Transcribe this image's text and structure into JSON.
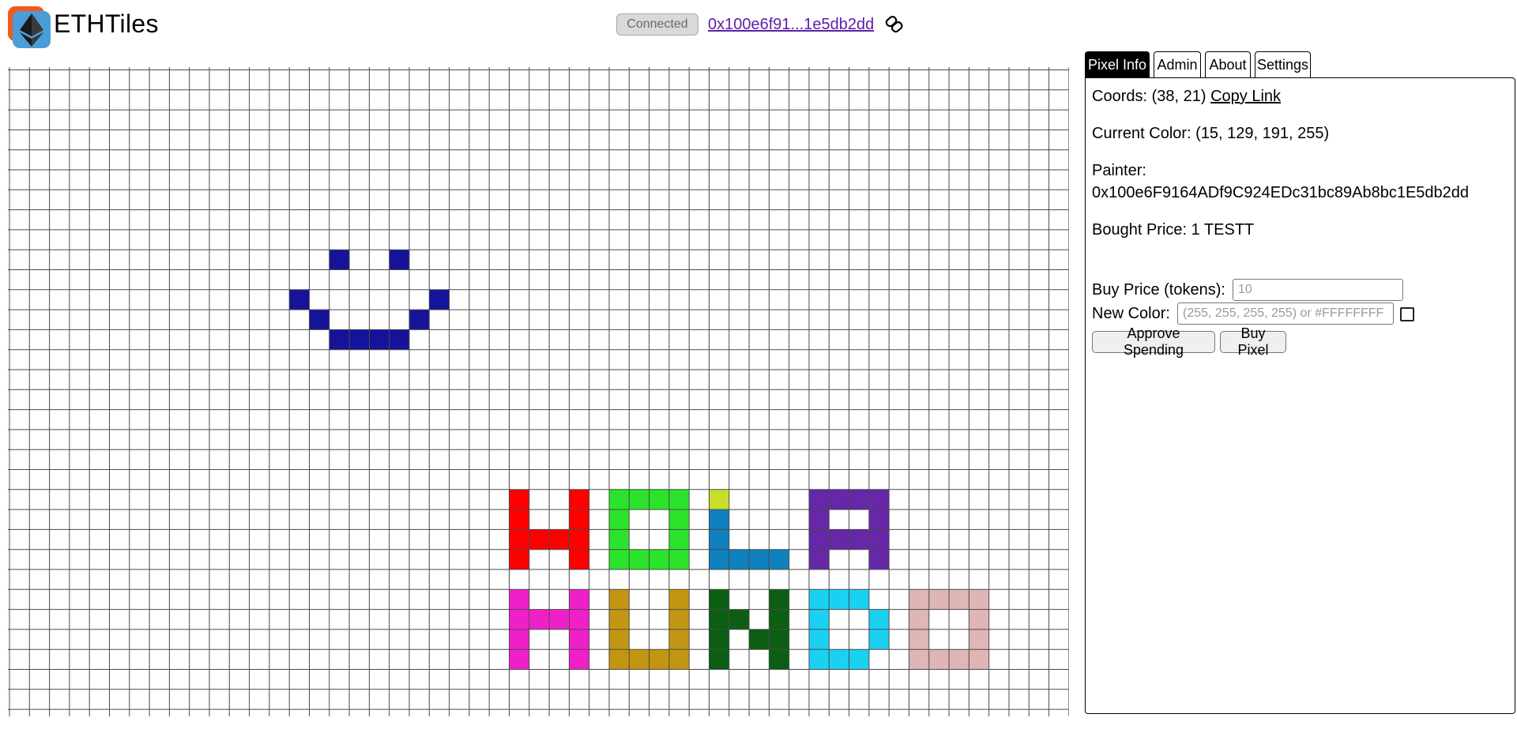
{
  "header": {
    "brand": "ETHTiles",
    "connection_status": "Connected",
    "account_short": "0x100e6f91...1e5db2dd"
  },
  "canvas": {
    "pixels": [
      {
        "x": 16,
        "y": 9,
        "color": "#15139a"
      },
      {
        "x": 19,
        "y": 9,
        "color": "#15139a"
      },
      {
        "x": 14,
        "y": 11,
        "color": "#15139a"
      },
      {
        "x": 21,
        "y": 11,
        "color": "#15139a"
      },
      {
        "x": 15,
        "y": 12,
        "color": "#15139a"
      },
      {
        "x": 20,
        "y": 12,
        "color": "#15139a"
      },
      {
        "x": 16,
        "y": 13,
        "color": "#15139a"
      },
      {
        "x": 17,
        "y": 13,
        "color": "#15139a"
      },
      {
        "x": 18,
        "y": 13,
        "color": "#15139a"
      },
      {
        "x": 19,
        "y": 13,
        "color": "#15139a"
      },
      {
        "x": 25,
        "y": 21,
        "color": "#ff0000"
      },
      {
        "x": 25,
        "y": 22,
        "color": "#ff0000"
      },
      {
        "x": 25,
        "y": 23,
        "color": "#ff0000"
      },
      {
        "x": 25,
        "y": 24,
        "color": "#ff0000"
      },
      {
        "x": 26,
        "y": 23,
        "color": "#ff0000"
      },
      {
        "x": 28,
        "y": 21,
        "color": "#ff0000"
      },
      {
        "x": 28,
        "y": 22,
        "color": "#ff0000"
      },
      {
        "x": 28,
        "y": 23,
        "color": "#ff0000"
      },
      {
        "x": 28,
        "y": 24,
        "color": "#ff0000"
      },
      {
        "x": 27,
        "y": 23,
        "color": "#ff0000"
      },
      {
        "x": 30,
        "y": 21,
        "color": "#2be32b"
      },
      {
        "x": 31,
        "y": 21,
        "color": "#2be32b"
      },
      {
        "x": 32,
        "y": 21,
        "color": "#2be32b"
      },
      {
        "x": 33,
        "y": 21,
        "color": "#2be32b"
      },
      {
        "x": 30,
        "y": 22,
        "color": "#2be32b"
      },
      {
        "x": 33,
        "y": 22,
        "color": "#2be32b"
      },
      {
        "x": 30,
        "y": 23,
        "color": "#2be32b"
      },
      {
        "x": 33,
        "y": 23,
        "color": "#2be32b"
      },
      {
        "x": 30,
        "y": 24,
        "color": "#2be32b"
      },
      {
        "x": 31,
        "y": 24,
        "color": "#2be32b"
      },
      {
        "x": 32,
        "y": 24,
        "color": "#2be32b"
      },
      {
        "x": 33,
        "y": 24,
        "color": "#2be32b"
      },
      {
        "x": 35,
        "y": 21,
        "color": "#c9dd2b"
      },
      {
        "x": 35,
        "y": 22,
        "color": "#0f81bf"
      },
      {
        "x": 35,
        "y": 23,
        "color": "#0f81bf"
      },
      {
        "x": 35,
        "y": 24,
        "color": "#0f81bf"
      },
      {
        "x": 36,
        "y": 24,
        "color": "#0f81bf"
      },
      {
        "x": 37,
        "y": 24,
        "color": "#0f81bf"
      },
      {
        "x": 38,
        "y": 24,
        "color": "#0f81bf"
      },
      {
        "x": 40,
        "y": 21,
        "color": "#6627a8"
      },
      {
        "x": 41,
        "y": 21,
        "color": "#6627a8"
      },
      {
        "x": 42,
        "y": 21,
        "color": "#6627a8"
      },
      {
        "x": 43,
        "y": 21,
        "color": "#6627a8"
      },
      {
        "x": 40,
        "y": 22,
        "color": "#6627a8"
      },
      {
        "x": 43,
        "y": 22,
        "color": "#6627a8"
      },
      {
        "x": 40,
        "y": 23,
        "color": "#6627a8"
      },
      {
        "x": 41,
        "y": 23,
        "color": "#6627a8"
      },
      {
        "x": 42,
        "y": 23,
        "color": "#6627a8"
      },
      {
        "x": 43,
        "y": 23,
        "color": "#6627a8"
      },
      {
        "x": 40,
        "y": 24,
        "color": "#6627a8"
      },
      {
        "x": 43,
        "y": 24,
        "color": "#6627a8"
      },
      {
        "x": 25,
        "y": 26,
        "color": "#f020c9"
      },
      {
        "x": 25,
        "y": 27,
        "color": "#f020c9"
      },
      {
        "x": 25,
        "y": 28,
        "color": "#f020c9"
      },
      {
        "x": 25,
        "y": 29,
        "color": "#f020c9"
      },
      {
        "x": 26,
        "y": 27,
        "color": "#f020c9"
      },
      {
        "x": 27,
        "y": 27,
        "color": "#f020c9"
      },
      {
        "x": 28,
        "y": 26,
        "color": "#f020c9"
      },
      {
        "x": 28,
        "y": 27,
        "color": "#f020c9"
      },
      {
        "x": 28,
        "y": 28,
        "color": "#f020c9"
      },
      {
        "x": 28,
        "y": 29,
        "color": "#f020c9"
      },
      {
        "x": 30,
        "y": 26,
        "color": "#c29612"
      },
      {
        "x": 30,
        "y": 27,
        "color": "#c29612"
      },
      {
        "x": 30,
        "y": 28,
        "color": "#c29612"
      },
      {
        "x": 30,
        "y": 29,
        "color": "#c29612"
      },
      {
        "x": 31,
        "y": 29,
        "color": "#c29612"
      },
      {
        "x": 32,
        "y": 29,
        "color": "#c29612"
      },
      {
        "x": 33,
        "y": 26,
        "color": "#c29612"
      },
      {
        "x": 33,
        "y": 27,
        "color": "#c29612"
      },
      {
        "x": 33,
        "y": 28,
        "color": "#c29612"
      },
      {
        "x": 33,
        "y": 29,
        "color": "#c29612"
      },
      {
        "x": 35,
        "y": 26,
        "color": "#0b5e12"
      },
      {
        "x": 35,
        "y": 27,
        "color": "#0b5e12"
      },
      {
        "x": 35,
        "y": 28,
        "color": "#0b5e12"
      },
      {
        "x": 35,
        "y": 29,
        "color": "#0b5e12"
      },
      {
        "x": 36,
        "y": 27,
        "color": "#0b5e12"
      },
      {
        "x": 37,
        "y": 28,
        "color": "#0b5e12"
      },
      {
        "x": 38,
        "y": 26,
        "color": "#0b5e12"
      },
      {
        "x": 38,
        "y": 27,
        "color": "#0b5e12"
      },
      {
        "x": 38,
        "y": 28,
        "color": "#0b5e12"
      },
      {
        "x": 38,
        "y": 29,
        "color": "#0b5e12"
      },
      {
        "x": 40,
        "y": 26,
        "color": "#1ad1f2"
      },
      {
        "x": 41,
        "y": 26,
        "color": "#1ad1f2"
      },
      {
        "x": 42,
        "y": 26,
        "color": "#1ad1f2"
      },
      {
        "x": 40,
        "y": 27,
        "color": "#1ad1f2"
      },
      {
        "x": 43,
        "y": 27,
        "color": "#1ad1f2"
      },
      {
        "x": 40,
        "y": 28,
        "color": "#1ad1f2"
      },
      {
        "x": 43,
        "y": 28,
        "color": "#1ad1f2"
      },
      {
        "x": 40,
        "y": 29,
        "color": "#1ad1f2"
      },
      {
        "x": 41,
        "y": 29,
        "color": "#1ad1f2"
      },
      {
        "x": 42,
        "y": 29,
        "color": "#1ad1f2"
      },
      {
        "x": 45,
        "y": 26,
        "color": "#dfb5b5"
      },
      {
        "x": 46,
        "y": 26,
        "color": "#dfb5b5"
      },
      {
        "x": 47,
        "y": 26,
        "color": "#dfb5b5"
      },
      {
        "x": 48,
        "y": 26,
        "color": "#dfb5b5"
      },
      {
        "x": 45,
        "y": 27,
        "color": "#dfb5b5"
      },
      {
        "x": 48,
        "y": 27,
        "color": "#dfb5b5"
      },
      {
        "x": 45,
        "y": 28,
        "color": "#dfb5b5"
      },
      {
        "x": 48,
        "y": 28,
        "color": "#dfb5b5"
      },
      {
        "x": 45,
        "y": 29,
        "color": "#dfb5b5"
      },
      {
        "x": 46,
        "y": 29,
        "color": "#dfb5b5"
      },
      {
        "x": 47,
        "y": 29,
        "color": "#dfb5b5"
      },
      {
        "x": 48,
        "y": 29,
        "color": "#dfb5b5"
      }
    ]
  },
  "tabs": [
    {
      "label": "Pixel Info",
      "active": true
    },
    {
      "label": "Admin",
      "active": false
    },
    {
      "label": "About",
      "active": false
    },
    {
      "label": "Settings",
      "active": false
    }
  ],
  "pixel_info": {
    "coords_text": "Coords: (38, 21)",
    "copy_link": "Copy Link",
    "current_color_text": "Current Color: (15, 129, 191, 255)",
    "painter_label": "Painter:",
    "painter_address": "0x100e6F9164ADf9C924EDc31bc89Ab8bc1E5db2dd",
    "bought_price_text": "Bought Price: 1 TESTT",
    "buy_price_label": "Buy Price (tokens):",
    "buy_price_placeholder": "10",
    "new_color_label": "New Color:",
    "new_color_placeholder": "(255, 255, 255, 255) or #FFFFFFFF",
    "approve_button": "Approve Spending",
    "buy_button": "Buy Pixel"
  }
}
